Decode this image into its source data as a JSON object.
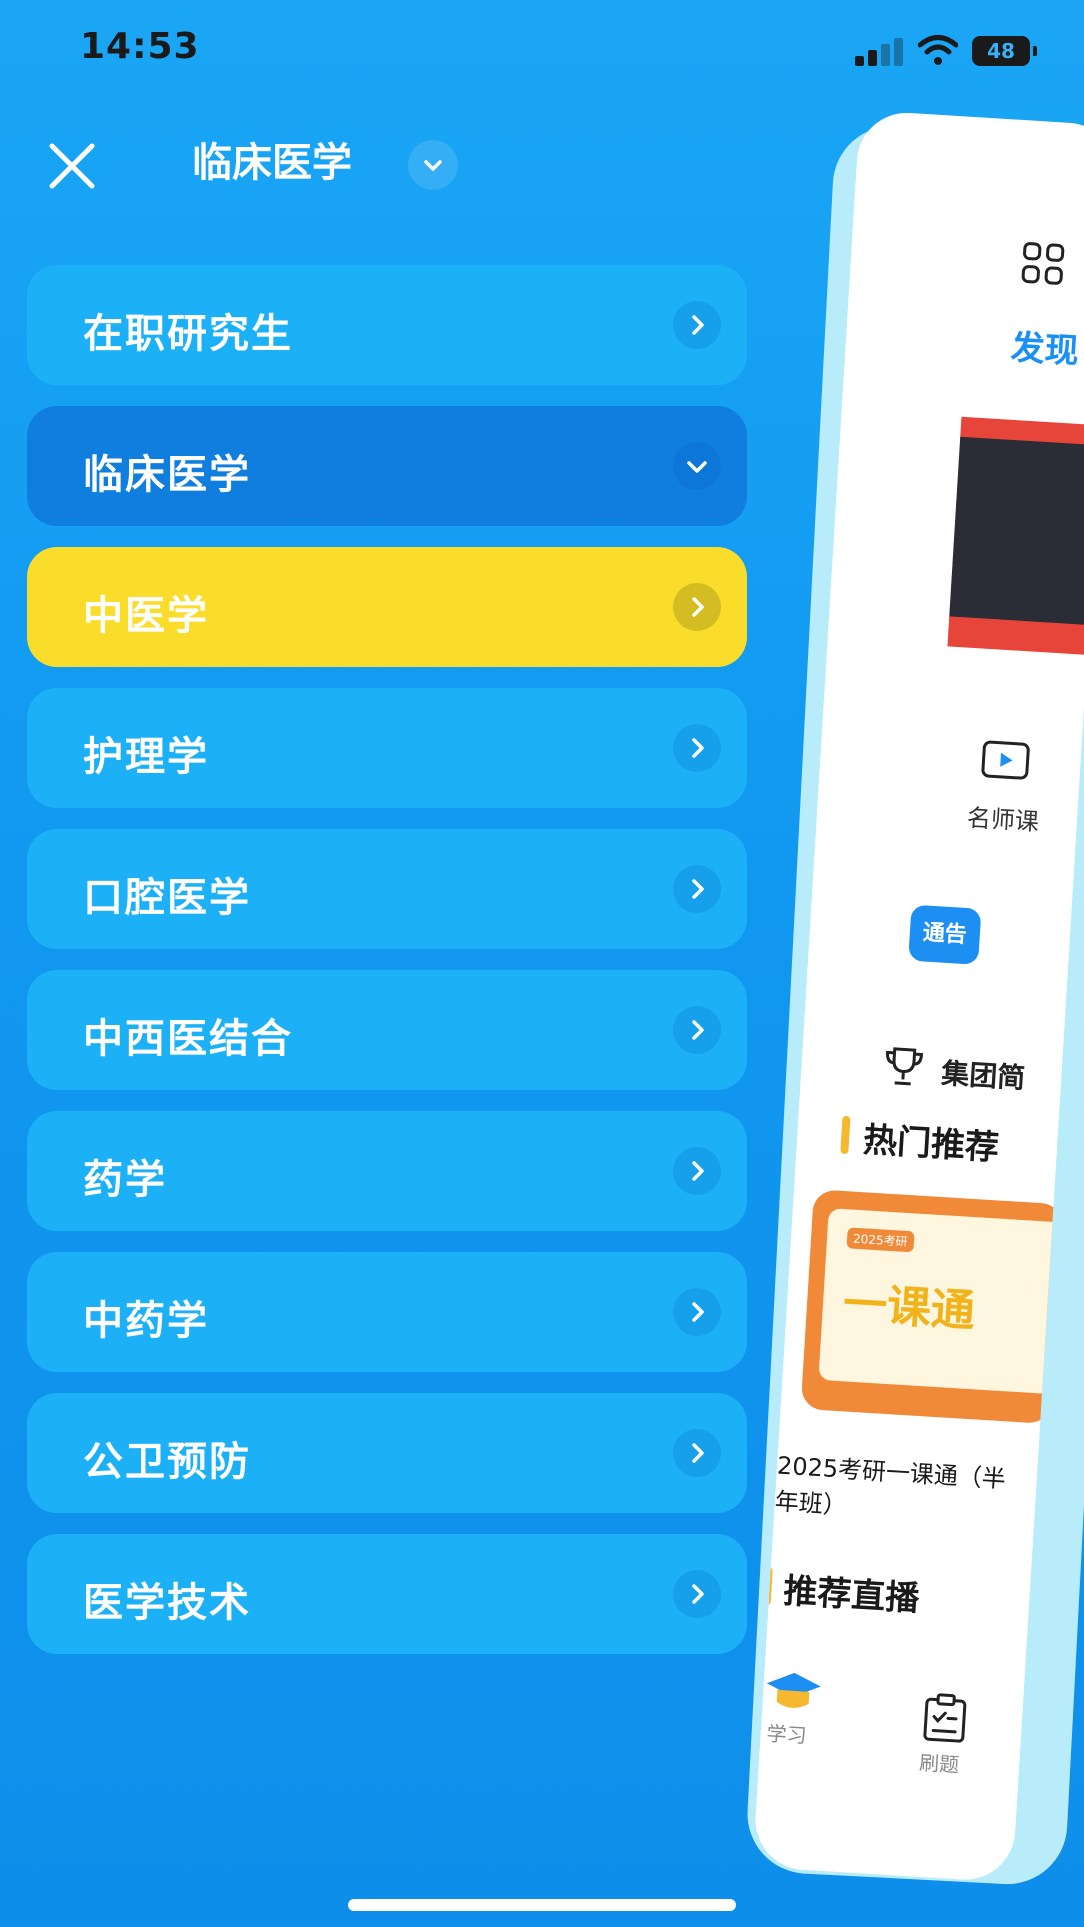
{
  "status_bar": {
    "time": "14:53",
    "battery": "48"
  },
  "header": {
    "title": "临床医学"
  },
  "categories": [
    {
      "label": "在职研究生",
      "state": "normal"
    },
    {
      "label": "临床医学",
      "state": "expanded"
    },
    {
      "label": "中医学",
      "state": "active"
    },
    {
      "label": "护理学",
      "state": "normal"
    },
    {
      "label": "口腔医学",
      "state": "normal"
    },
    {
      "label": "中西医结合",
      "state": "normal"
    },
    {
      "label": "药学",
      "state": "normal"
    },
    {
      "label": "中药学",
      "state": "normal"
    },
    {
      "label": "公卫预防",
      "state": "normal"
    },
    {
      "label": "医学技术",
      "state": "normal"
    }
  ],
  "preview": {
    "discover": "发现",
    "teacher_courses": "名师课",
    "notice_badge": "通告",
    "group_label": "集团简",
    "hot_recommend": "热门推荐",
    "course_tag": "2025考研",
    "course_big": "一课通",
    "course_title": "2025考研一课通（半年班）",
    "live_recommend": "推荐直播",
    "tab_learn": "学习",
    "tab_practice": "刷题"
  },
  "colors": {
    "background": "#1198f0",
    "item": "#1cb0f7",
    "item_expanded": "#0f7ede",
    "item_active": "#f9dd2a",
    "accent_orange": "#f08a38"
  }
}
